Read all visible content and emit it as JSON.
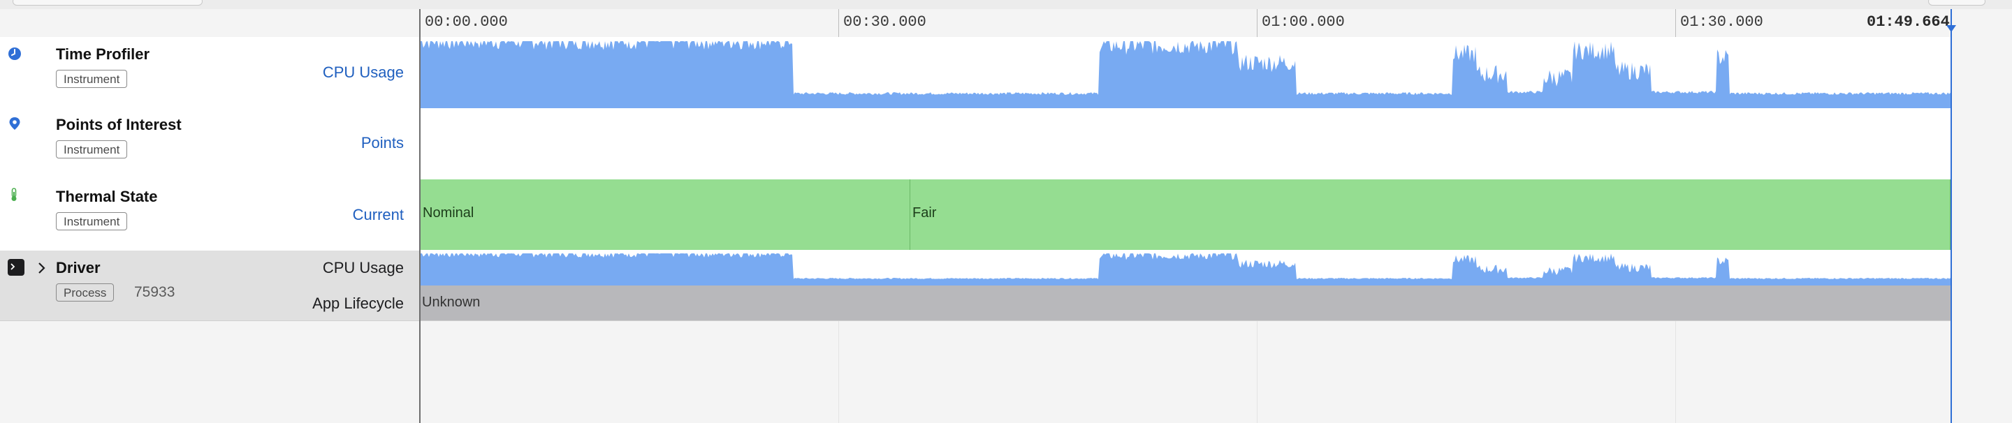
{
  "timeline": {
    "ticks": [
      "00:00.000",
      "00:30.000",
      "01:00.000",
      "01:30.000"
    ],
    "end_time": "01:49.664"
  },
  "tracks": [
    {
      "title": "Time Profiler",
      "badge": "Instrument",
      "metric": "CPU Usage",
      "icon": "clock-icon",
      "color": "#2f6fd6"
    },
    {
      "title": "Points of Interest",
      "badge": "Instrument",
      "metric": "Points",
      "icon": "map-pin-icon",
      "color": "#2f6fd6"
    },
    {
      "title": "Thermal State",
      "badge": "Instrument",
      "metric": "Current",
      "icon": "thermometer-icon",
      "color": "#4caf50"
    }
  ],
  "thermal": {
    "segments": [
      "Nominal",
      "Fair"
    ]
  },
  "driver": {
    "title": "Driver",
    "badge": "Process",
    "pid": "75933",
    "icon": "terminal-icon",
    "metrics": [
      "CPU Usage",
      "App Lifecycle"
    ],
    "lifecycle": "Unknown"
  },
  "colors": {
    "cpu": "#78aaf2",
    "thermal": "#95dd91",
    "lifecycle": "#b8b8bb",
    "accent": "#2f6fd6"
  }
}
